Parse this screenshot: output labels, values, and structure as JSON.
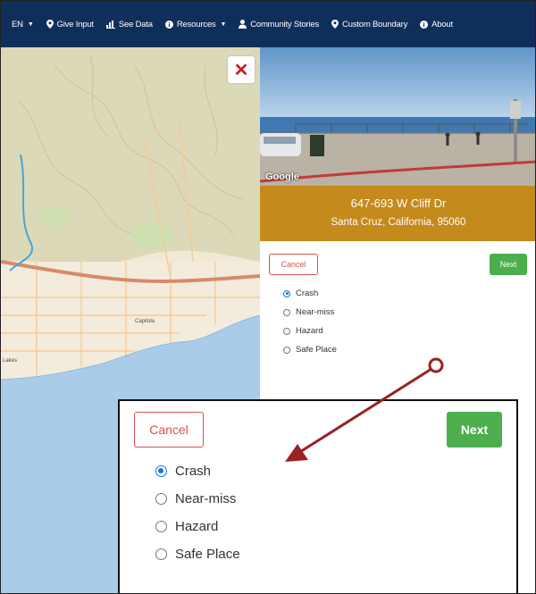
{
  "nav": {
    "items": [
      {
        "label": "EN",
        "icon": "none",
        "dropdown": true
      },
      {
        "label": "Give Input",
        "icon": "map-pin-icon",
        "dropdown": false
      },
      {
        "label": "See Data",
        "icon": "bar-chart-icon",
        "dropdown": false
      },
      {
        "label": "Resources",
        "icon": "info-circle-icon",
        "dropdown": true
      },
      {
        "label": "Community Stories",
        "icon": "person-icon",
        "dropdown": false
      },
      {
        "label": "Custom Boundary",
        "icon": "map-pin-icon",
        "dropdown": false
      },
      {
        "label": "About",
        "icon": "info-circle-icon",
        "dropdown": false
      }
    ]
  },
  "map": {
    "labels": {
      "capitola": "Capitola",
      "lakes": "Lakes"
    }
  },
  "panel": {
    "close_symbol": "✕",
    "photo_brand": "Google",
    "address_line1": "647-693 W Cliff Dr",
    "address_line2": "Santa Cruz, California, 95060",
    "cancel_label": "Cancel",
    "next_label": "Next",
    "options": [
      "Crash",
      "Near-miss",
      "Hazard",
      "Safe Place"
    ],
    "selected_option": "Crash"
  },
  "zoom": {
    "cancel_label": "Cancel",
    "next_label": "Next",
    "options": [
      "Crash",
      "Near-miss",
      "Hazard",
      "Safe Place"
    ],
    "selected_option": "Crash"
  },
  "colors": {
    "navbar": "#0f2f5b",
    "address_bar": "#c48a1c",
    "next_green": "#4cae4c",
    "cancel_red": "#d9534f",
    "arrow": "#9b2222"
  }
}
